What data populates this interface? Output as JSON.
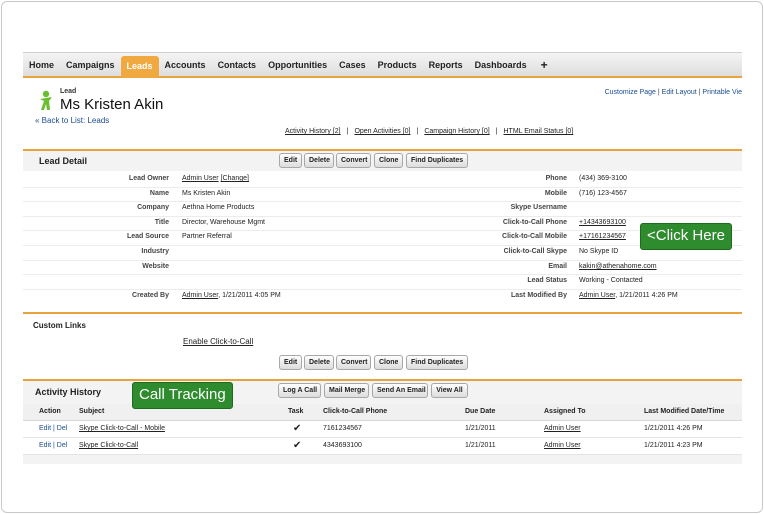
{
  "tabs": [
    "Home",
    "Campaigns",
    "Leads",
    "Accounts",
    "Contacts",
    "Opportunities",
    "Cases",
    "Products",
    "Reports",
    "Dashboards",
    "+"
  ],
  "active_tab": "Leads",
  "header": {
    "type_label": "Lead",
    "title": "Ms Kristen Akin",
    "back_link": "« Back to List: Leads",
    "top_links": [
      "Customize Page",
      "Edit Layout",
      "Printable Vie"
    ],
    "related_links": [
      "Activity History [2]",
      "Open Activities [0]",
      "Campaign History [0]",
      "HTML Email Status [0]"
    ]
  },
  "detail": {
    "title": "Lead Detail",
    "buttons": [
      "Edit",
      "Delete",
      "Convert",
      "Clone",
      "Find Duplicates"
    ],
    "left_fields": [
      {
        "label": "Lead Owner",
        "value": "Admin User",
        "extra": "[Change]"
      },
      {
        "label": "Name",
        "value": "Ms Kristen Akin"
      },
      {
        "label": "Company",
        "value": "Aethna Home Products"
      },
      {
        "label": "Title",
        "value": "Director, Warehouse Mgmt"
      },
      {
        "label": "Lead Source",
        "value": "Partner Referral"
      },
      {
        "label": "Industry",
        "value": ""
      },
      {
        "label": "Website",
        "value": ""
      },
      {
        "label": "",
        "value": ""
      },
      {
        "label": "Created By",
        "value": "Admin User",
        "extra": ", 1/21/2011 4:05 PM"
      }
    ],
    "right_fields": [
      {
        "label": "Phone",
        "value": "(434) 369-3100"
      },
      {
        "label": "Mobile",
        "value": "(716) 123-4567"
      },
      {
        "label": "Skype Username",
        "value": ""
      },
      {
        "label": "Click-to-Call Phone",
        "value": "+14343693100"
      },
      {
        "label": "Click-to-Call Mobile",
        "value": "+17161234567"
      },
      {
        "label": "Click-to-Call Skype",
        "value": "No Skype ID"
      },
      {
        "label": "Email",
        "value": "kakin@athenahome.com"
      },
      {
        "label": "Lead Status",
        "value": "Working - Contacted"
      },
      {
        "label": "Last Modified By",
        "value": "Admin User",
        "extra": ", 1/21/2011 4:26 PM"
      }
    ]
  },
  "custom_links": {
    "title": "Custom Links",
    "link": "Enable Click-to-Call",
    "buttons": [
      "Edit",
      "Delete",
      "Convert",
      "Clone",
      "Find Duplicates"
    ]
  },
  "activity": {
    "title": "Activity History",
    "buttons": [
      "Log A Call",
      "Mail Merge",
      "Send An Email",
      "View All"
    ],
    "columns": [
      "Action",
      "Subject",
      "Task",
      "Click-to-Call Phone",
      "Due Date",
      "Assigned To",
      "Last Modified Date/Time"
    ],
    "rows": [
      {
        "action": "Edit | Del",
        "subject": "Skype Click-to-Call - Mobile",
        "task": "✔",
        "phone": "7161234567",
        "due": "1/21/2011",
        "assigned": "Admin User",
        "modified": "1/21/2011 4:26 PM"
      },
      {
        "action": "Edit | Del",
        "subject": "Skype Click-to-Call",
        "task": "✔",
        "phone": "4343693100",
        "due": "1/21/2011",
        "assigned": "Admin User",
        "modified": "1/21/2011 4:23 PM"
      }
    ]
  },
  "callouts": {
    "click_here": "<Click Here",
    "call_tracking": "Call Tracking"
  },
  "colors": {
    "accent": "#e8a33d",
    "callout": "#2e8b2e",
    "link": "#1a4d8f"
  }
}
